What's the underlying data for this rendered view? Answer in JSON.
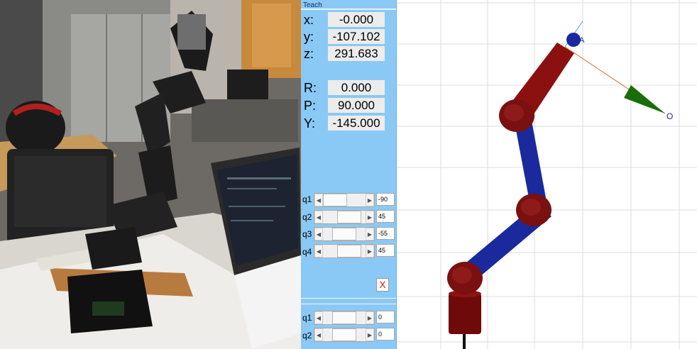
{
  "teach": {
    "title": "Teach",
    "pose": [
      {
        "label": "x:",
        "value": "-0.000"
      },
      {
        "label": "y:",
        "value": "-107.102"
      },
      {
        "label": "z:",
        "value": "291.683"
      }
    ],
    "orientation": [
      {
        "label": "R:",
        "value": "0.000"
      },
      {
        "label": "P:",
        "value": "90.000"
      },
      {
        "label": "Y:",
        "value": "-145.000"
      }
    ],
    "joints": [
      {
        "label": "q1",
        "value": "-90",
        "fraction": 0.0
      },
      {
        "label": "q2",
        "value": "45",
        "fraction": 0.75
      },
      {
        "label": "q3",
        "value": "-55",
        "fraction": 0.49
      },
      {
        "label": "q4",
        "value": "45",
        "fraction": 0.75
      }
    ],
    "close_label": "X",
    "joints2": [
      {
        "label": "q1",
        "value": "0",
        "fraction": 0.5
      },
      {
        "label": "q2",
        "value": "0",
        "fraction": 0.5
      }
    ]
  },
  "view": {
    "tool_label_a": "A",
    "tool_label_o": "O",
    "colors": {
      "link_red": "#8b1010",
      "link_blue": "#1a2a9c",
      "joint": "#7a1010",
      "approach": "#1a6e0a"
    }
  },
  "photo": {
    "description_icon": "robot-arm-photo"
  }
}
